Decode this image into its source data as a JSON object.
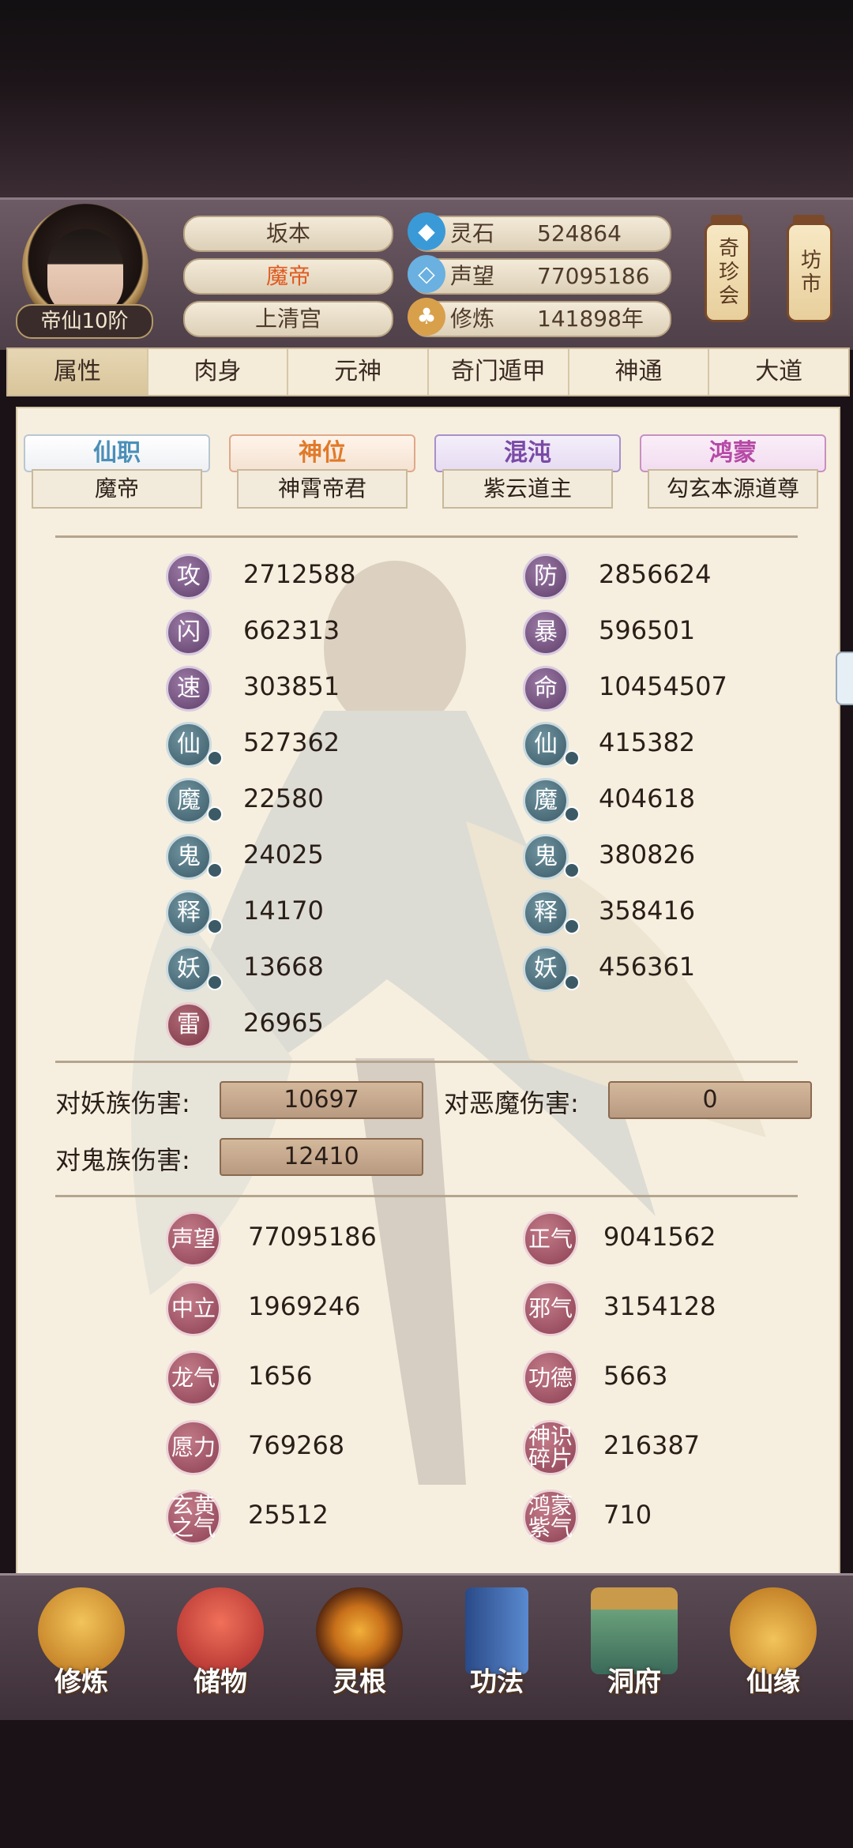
{
  "profile": {
    "name": "坂本",
    "title": "魔帝",
    "sect": "上清宫",
    "rank": "帝仙10阶"
  },
  "resources": [
    {
      "icon": "spirit-stone-icon",
      "label": "灵石",
      "value": "524864"
    },
    {
      "icon": "reputation-icon",
      "label": "声望",
      "value": "77095186"
    },
    {
      "icon": "cultivation-icon",
      "label": "修炼",
      "value": "141898年"
    }
  ],
  "side_buttons": {
    "treasure": "奇珍会",
    "market": "坊市"
  },
  "tabs": [
    "属性",
    "肉身",
    "元神",
    "奇门遁甲",
    "神通",
    "大道"
  ],
  "titles": [
    {
      "label": "仙职",
      "value": "魔帝",
      "color": "#4a8fb8"
    },
    {
      "label": "神位",
      "value": "神霄帝君",
      "color": "#e07a2a"
    },
    {
      "label": "混沌",
      "value": "紫云道主",
      "color": "#7a4aa6"
    },
    {
      "label": "鸿蒙",
      "value": "勾玄本源道尊",
      "color": "#b64aa6"
    }
  ],
  "stats_left": [
    {
      "char": "攻",
      "value": "2712588",
      "style": "purple"
    },
    {
      "char": "闪",
      "value": "662313",
      "style": "purple"
    },
    {
      "char": "速",
      "value": "303851",
      "style": "purple"
    },
    {
      "char": "仙",
      "value": "527362",
      "style": "blue"
    },
    {
      "char": "魔",
      "value": "22580",
      "style": "blue"
    },
    {
      "char": "鬼",
      "value": "24025",
      "style": "blue"
    },
    {
      "char": "释",
      "value": "14170",
      "style": "blue"
    },
    {
      "char": "妖",
      "value": "13668",
      "style": "blue"
    },
    {
      "char": "雷",
      "value": "26965",
      "style": "red"
    }
  ],
  "stats_right": [
    {
      "char": "防",
      "value": "2856624",
      "style": "purple"
    },
    {
      "char": "暴",
      "value": "596501",
      "style": "purple"
    },
    {
      "char": "命",
      "value": "10454507",
      "style": "purple"
    },
    {
      "char": "仙",
      "value": "415382",
      "style": "blue"
    },
    {
      "char": "魔",
      "value": "404618",
      "style": "blue"
    },
    {
      "char": "鬼",
      "value": "380826",
      "style": "blue"
    },
    {
      "char": "释",
      "value": "358416",
      "style": "blue"
    },
    {
      "char": "妖",
      "value": "456361",
      "style": "blue"
    }
  ],
  "damage": {
    "vs_yao_label": "对妖族伤害:",
    "vs_yao": "10697",
    "vs_demon_label": "对恶魔伤害:",
    "vs_demon": "0",
    "vs_ghost_label": "对鬼族伤害:",
    "vs_ghost": "12410"
  },
  "virtues_left": [
    {
      "char": "声望",
      "value": "77095186"
    },
    {
      "char": "中立",
      "value": "1969246"
    },
    {
      "char": "龙气",
      "value": "1656"
    },
    {
      "char": "愿力",
      "value": "769268"
    },
    {
      "char": "玄黄之气",
      "value": "25512"
    }
  ],
  "virtues_right": [
    {
      "char": "正气",
      "value": "9041562"
    },
    {
      "char": "邪气",
      "value": "3154128"
    },
    {
      "char": "功德",
      "value": "5663"
    },
    {
      "char": "神识碎片",
      "value": "216387"
    },
    {
      "char": "鸿蒙紫气",
      "value": "710"
    }
  ],
  "bottom_nav": [
    {
      "label": "修炼",
      "icon": "monk-icon",
      "color": "#d9942a"
    },
    {
      "label": "储物",
      "icon": "bag-icon",
      "color": "#c8423a"
    },
    {
      "label": "灵根",
      "icon": "triskelion-icon",
      "color": "#8a4a1a"
    },
    {
      "label": "功法",
      "icon": "book-icon",
      "color": "#3a6aa8"
    },
    {
      "label": "洞府",
      "icon": "palace-icon",
      "color": "#5a8a6a"
    },
    {
      "label": "仙缘",
      "icon": "gourd-icon",
      "color": "#d8a23a"
    }
  ]
}
